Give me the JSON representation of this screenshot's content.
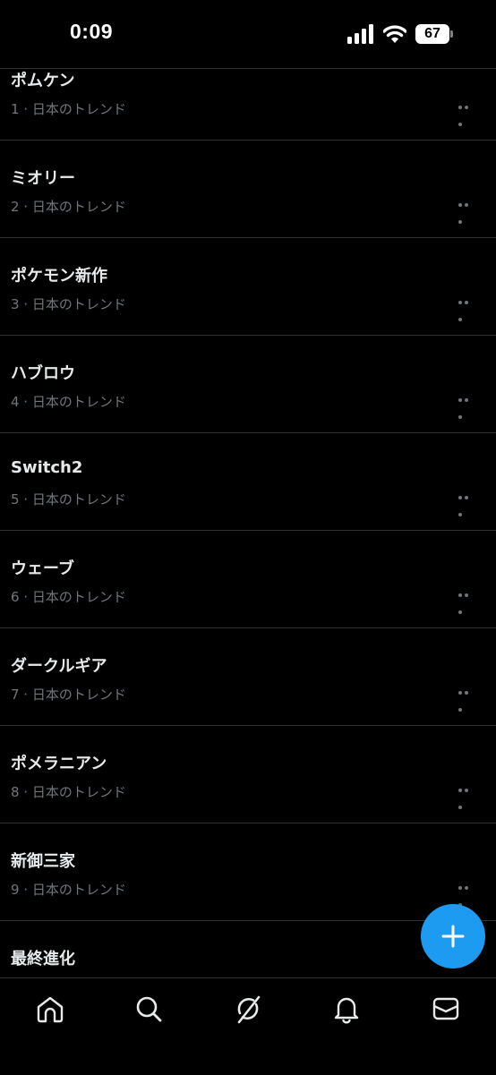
{
  "status_bar": {
    "time": "0:09",
    "battery_level": "67",
    "icons": [
      "cellular-signal-icon",
      "wifi-icon",
      "battery-icon"
    ]
  },
  "trends": [
    {
      "name": "ポムケン",
      "meta": "1 · 日本のトレンド"
    },
    {
      "name": "ミオリー",
      "meta": "2 · 日本のトレンド"
    },
    {
      "name": "ポケモン新作",
      "meta": "3 · 日本のトレンド"
    },
    {
      "name": "ハブロウ",
      "meta": "4 · 日本のトレンド"
    },
    {
      "name": "Switch2",
      "meta": "5 · 日本のトレンド"
    },
    {
      "name": "ウェーブ",
      "meta": "6 · 日本のトレンド"
    },
    {
      "name": "ダークルギア",
      "meta": "7 · 日本のトレンド"
    },
    {
      "name": "ポメラニアン",
      "meta": "8 · 日本のトレンド"
    },
    {
      "name": "新御三家",
      "meta": "9 · 日本のトレンド"
    },
    {
      "name": "最終進化",
      "meta": ""
    }
  ],
  "fab": {
    "icon": "plus-icon"
  },
  "tab_bar": {
    "tabs": [
      {
        "icon": "home-icon"
      },
      {
        "icon": "search-icon"
      },
      {
        "icon": "grok-icon"
      },
      {
        "icon": "bell-icon"
      },
      {
        "icon": "mail-icon"
      }
    ]
  },
  "colors": {
    "background": "#000000",
    "primary_text": "#e7e9ea",
    "secondary_text": "#71767b",
    "divider": "#2f3336",
    "accent": "#1d9bf0"
  }
}
